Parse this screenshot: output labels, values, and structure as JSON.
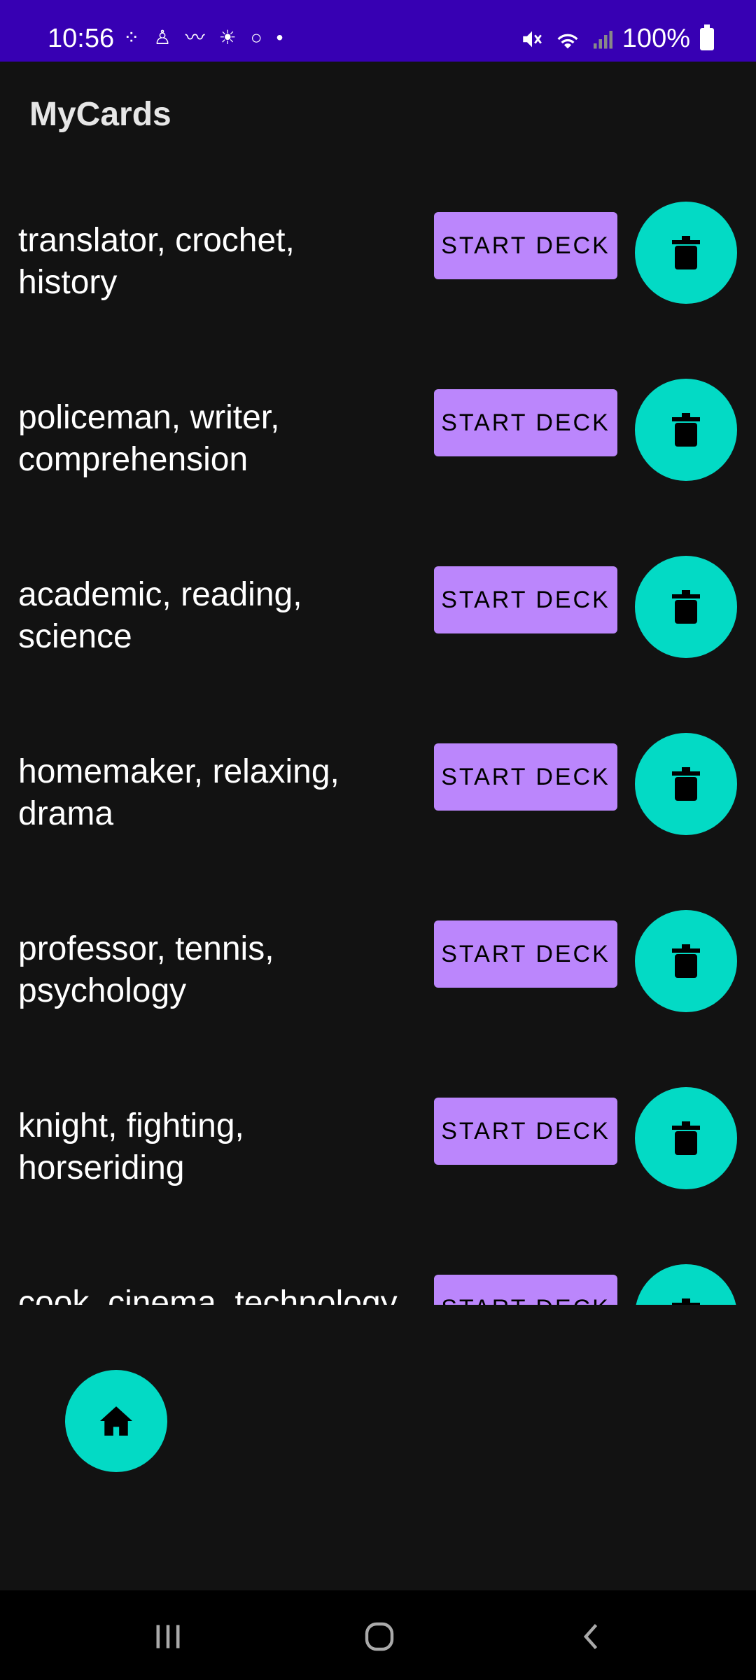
{
  "status_bar": {
    "time": "10:56",
    "battery": "100%",
    "icons": [
      "people-icon",
      "person-icon",
      "game-icon",
      "weather-icon",
      "circle-icon",
      "dot-icon",
      "mute-icon",
      "wifi-icon",
      "signal-icon",
      "battery-icon"
    ]
  },
  "app": {
    "title": "MyCards"
  },
  "decks": [
    {
      "line1": "translator, crochet,",
      "line2": "history",
      "button": "START DECK"
    },
    {
      "line1": "policeman, writer,",
      "line2": "comprehension",
      "button": "START DECK"
    },
    {
      "line1": "academic, reading,",
      "line2": "science",
      "button": "START DECK"
    },
    {
      "line1": "homemaker, relaxing,",
      "line2": "drama",
      "button": "START DECK"
    },
    {
      "line1": "professor, tennis,",
      "line2": "psychology",
      "button": "START DECK"
    },
    {
      "line1": "knight, fighting,",
      "line2": "horseriding",
      "button": "START DECK"
    },
    {
      "line1": "cook, cinema, technology",
      "line2": "",
      "button": "START DECK"
    }
  ],
  "colors": {
    "status_bar": "#3700b3",
    "background": "#121212",
    "primary_button": "#bb86fc",
    "secondary_fab": "#03dac5"
  },
  "icons": {
    "delete": "trash-icon",
    "home": "home-icon"
  }
}
